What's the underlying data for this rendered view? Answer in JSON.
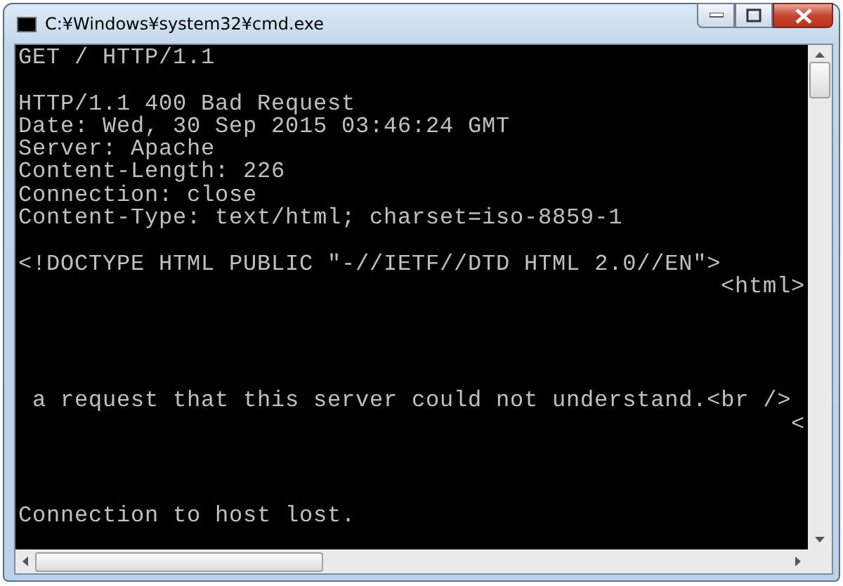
{
  "window": {
    "title": "C:¥Windows¥system32¥cmd.exe"
  },
  "console": {
    "lines": [
      {
        "kind": "left",
        "text": "GET / HTTP/1.1"
      },
      {
        "kind": "blank"
      },
      {
        "kind": "left",
        "text": "HTTP/1.1 400 Bad Request"
      },
      {
        "kind": "left",
        "text": "Date: Wed, 30 Sep 2015 03:46:24 GMT"
      },
      {
        "kind": "left",
        "text": "Server: Apache"
      },
      {
        "kind": "left",
        "text": "Content-Length: 226"
      },
      {
        "kind": "left",
        "text": "Connection: close"
      },
      {
        "kind": "left",
        "text": "Content-Type: text/html; charset=iso-8859-1"
      },
      {
        "kind": "blank"
      },
      {
        "kind": "left",
        "text": "<!DOCTYPE HTML PUBLIC \"-//IETF//DTD HTML 2.0//EN\">"
      },
      {
        "kind": "right",
        "text": "<html>"
      },
      {
        "kind": "blank"
      },
      {
        "kind": "blank"
      },
      {
        "kind": "blank"
      },
      {
        "kind": "blank"
      },
      {
        "kind": "indented",
        "text": "a request that this server could not understand.<br />"
      },
      {
        "kind": "right",
        "text": "<"
      },
      {
        "kind": "blank"
      },
      {
        "kind": "blank"
      },
      {
        "kind": "blank"
      },
      {
        "kind": "left",
        "text": "Connection to host lost."
      }
    ]
  }
}
